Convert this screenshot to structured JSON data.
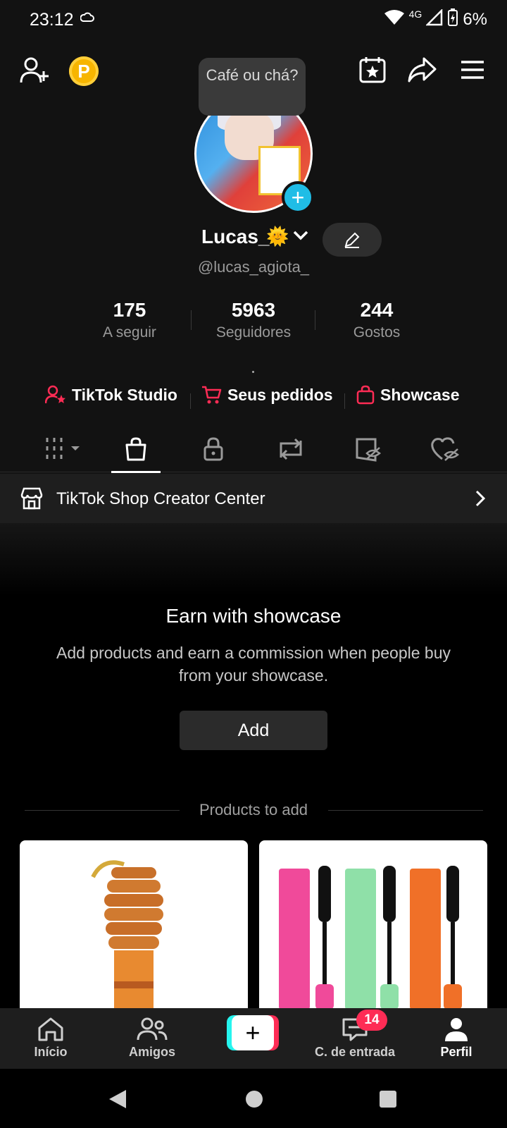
{
  "status_bar": {
    "time": "23:12",
    "network": "4G",
    "battery": "6%"
  },
  "top_bar": {
    "coin_letter": "P",
    "tooltip": "Café ou chá?"
  },
  "profile": {
    "username": "Lucas_",
    "username_emoji": "🌞",
    "handle": "@lucas_agiota_"
  },
  "stats": [
    {
      "value": "175",
      "label": "A seguir"
    },
    {
      "value": "5963",
      "label": "Seguidores"
    },
    {
      "value": "244",
      "label": "Gostos"
    }
  ],
  "links": [
    {
      "label": "TikTok Studio",
      "icon": "user-star-icon"
    },
    {
      "label": "Seus pedidos",
      "icon": "cart-icon"
    },
    {
      "label": "Showcase",
      "icon": "bag-icon"
    }
  ],
  "tabs": [
    "grid-icon",
    "bag-icon",
    "lock-icon",
    "repost-icon",
    "hidden-icon",
    "liked-hidden-icon"
  ],
  "shop_row": {
    "label": "TikTok Shop Creator Center"
  },
  "earn": {
    "title": "Earn with showcase",
    "description": "Add products and earn a commission when people buy from your showcase.",
    "add_label": "Add",
    "products_label": "Products to add"
  },
  "bottom_nav": {
    "home": "Início",
    "friends": "Amigos",
    "inbox": "C. de entrada",
    "inbox_badge": "14",
    "profile": "Perfil"
  },
  "colors": {
    "accent": "#fe2c55",
    "cyan": "#25f4ee",
    "background": "#121212"
  }
}
